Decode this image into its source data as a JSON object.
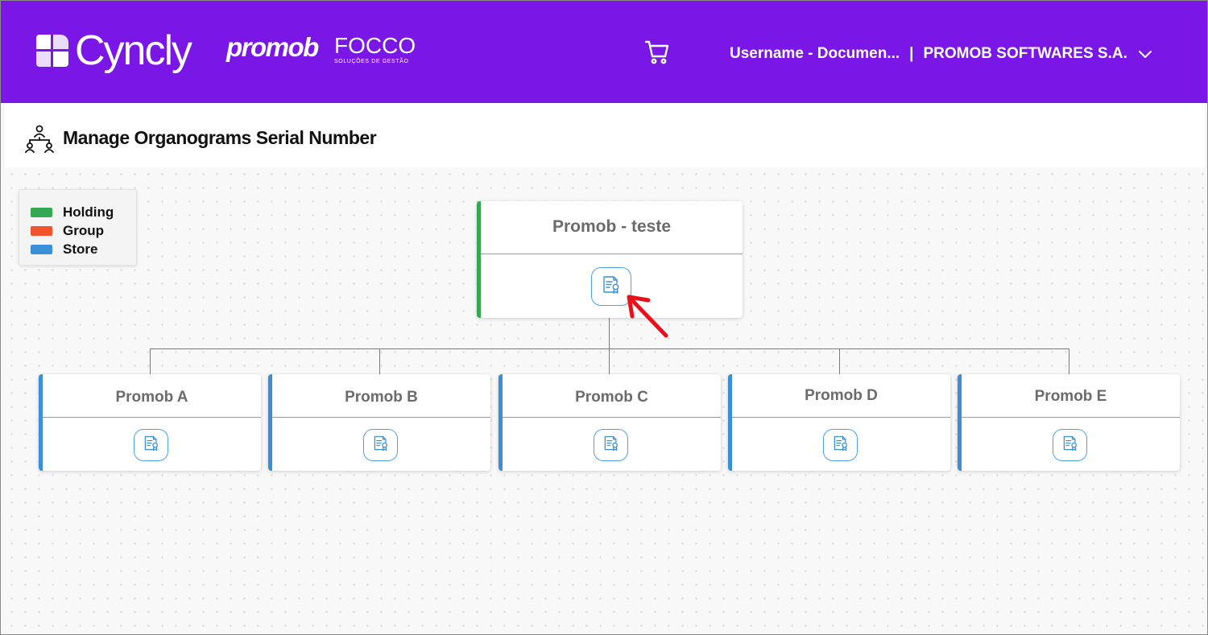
{
  "header": {
    "brand_cyncly": "Cyncly",
    "brand_promob": "promob",
    "brand_focco": "FOCCO",
    "brand_focco_tagline": "SOLUÇÕES DE GESTÃO",
    "user_name": "Username - Documen...",
    "separator": "|",
    "company": "PROMOB SOFTWARES S.A.",
    "icons": [
      "cart-icon",
      "chevron-down-icon"
    ]
  },
  "page": {
    "title": "Manage Organograms Serial Number",
    "icon": "organogram-icon"
  },
  "legend": {
    "items": [
      {
        "label": "Holding",
        "color": "#34a853"
      },
      {
        "label": "Group",
        "color": "#f0542f"
      },
      {
        "label": "Store",
        "color": "#3b8fd9"
      }
    ]
  },
  "organogram": {
    "root": {
      "name": "Promob - teste",
      "type": "Holding",
      "color": "#34a853",
      "action_icon": "serial-certificate-icon"
    },
    "children": [
      {
        "name": "Promob A",
        "type": "Store",
        "color": "#3b8fd9",
        "action_icon": "serial-certificate-icon"
      },
      {
        "name": "Promob B",
        "type": "Store",
        "color": "#3b8fd9",
        "action_icon": "serial-certificate-icon"
      },
      {
        "name": "Promob C",
        "type": "Store",
        "color": "#3b8fd9",
        "action_icon": "serial-certificate-icon"
      },
      {
        "name": "Promob D",
        "type": "Store",
        "color": "#3b8fd9",
        "action_icon": "serial-certificate-icon"
      },
      {
        "name": "Promob E",
        "type": "Store",
        "color": "#3b8fd9",
        "action_icon": "serial-certificate-icon"
      }
    ]
  },
  "colors": {
    "header_bg": "#7a16e6",
    "accent_blue": "#4aa3e6",
    "annotation_arrow": "#e8101a"
  }
}
